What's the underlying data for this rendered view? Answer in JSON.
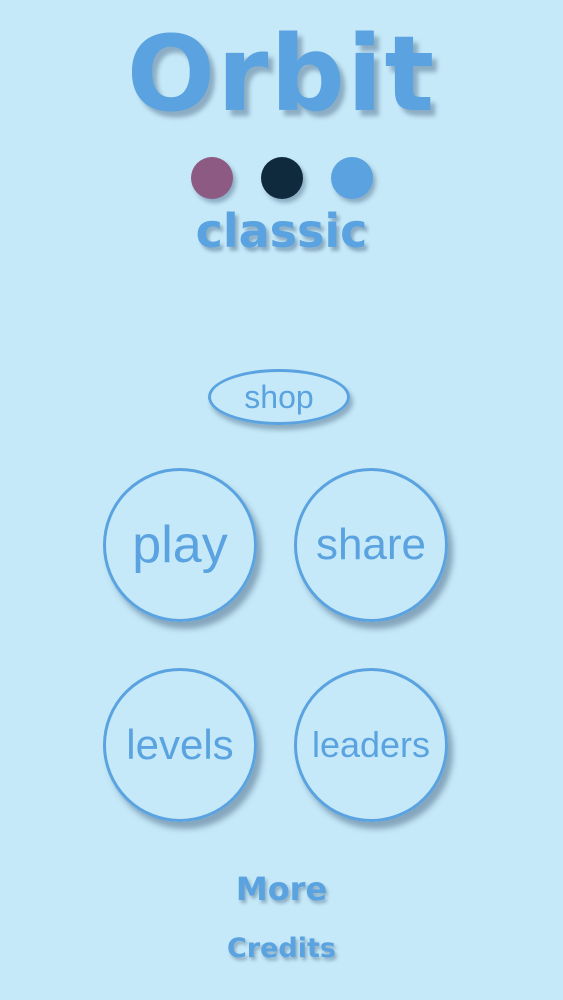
{
  "logo": {
    "title": "Orbit",
    "subtitle": "classic",
    "dots": [
      {
        "name": "purple-dot",
        "color": "#8c5a83"
      },
      {
        "name": "navy-dot",
        "color": "#0f2a3d"
      },
      {
        "name": "blue-dot",
        "color": "#5aa3e0"
      }
    ]
  },
  "menu": {
    "shop_label": "shop",
    "play_label": "play",
    "share_label": "share",
    "levels_label": "levels",
    "leaders_label": "leaders",
    "more_label": "More",
    "credits_label": "Credits"
  },
  "colors": {
    "background": "#c5e9f8",
    "accent": "#5aa3e0"
  }
}
